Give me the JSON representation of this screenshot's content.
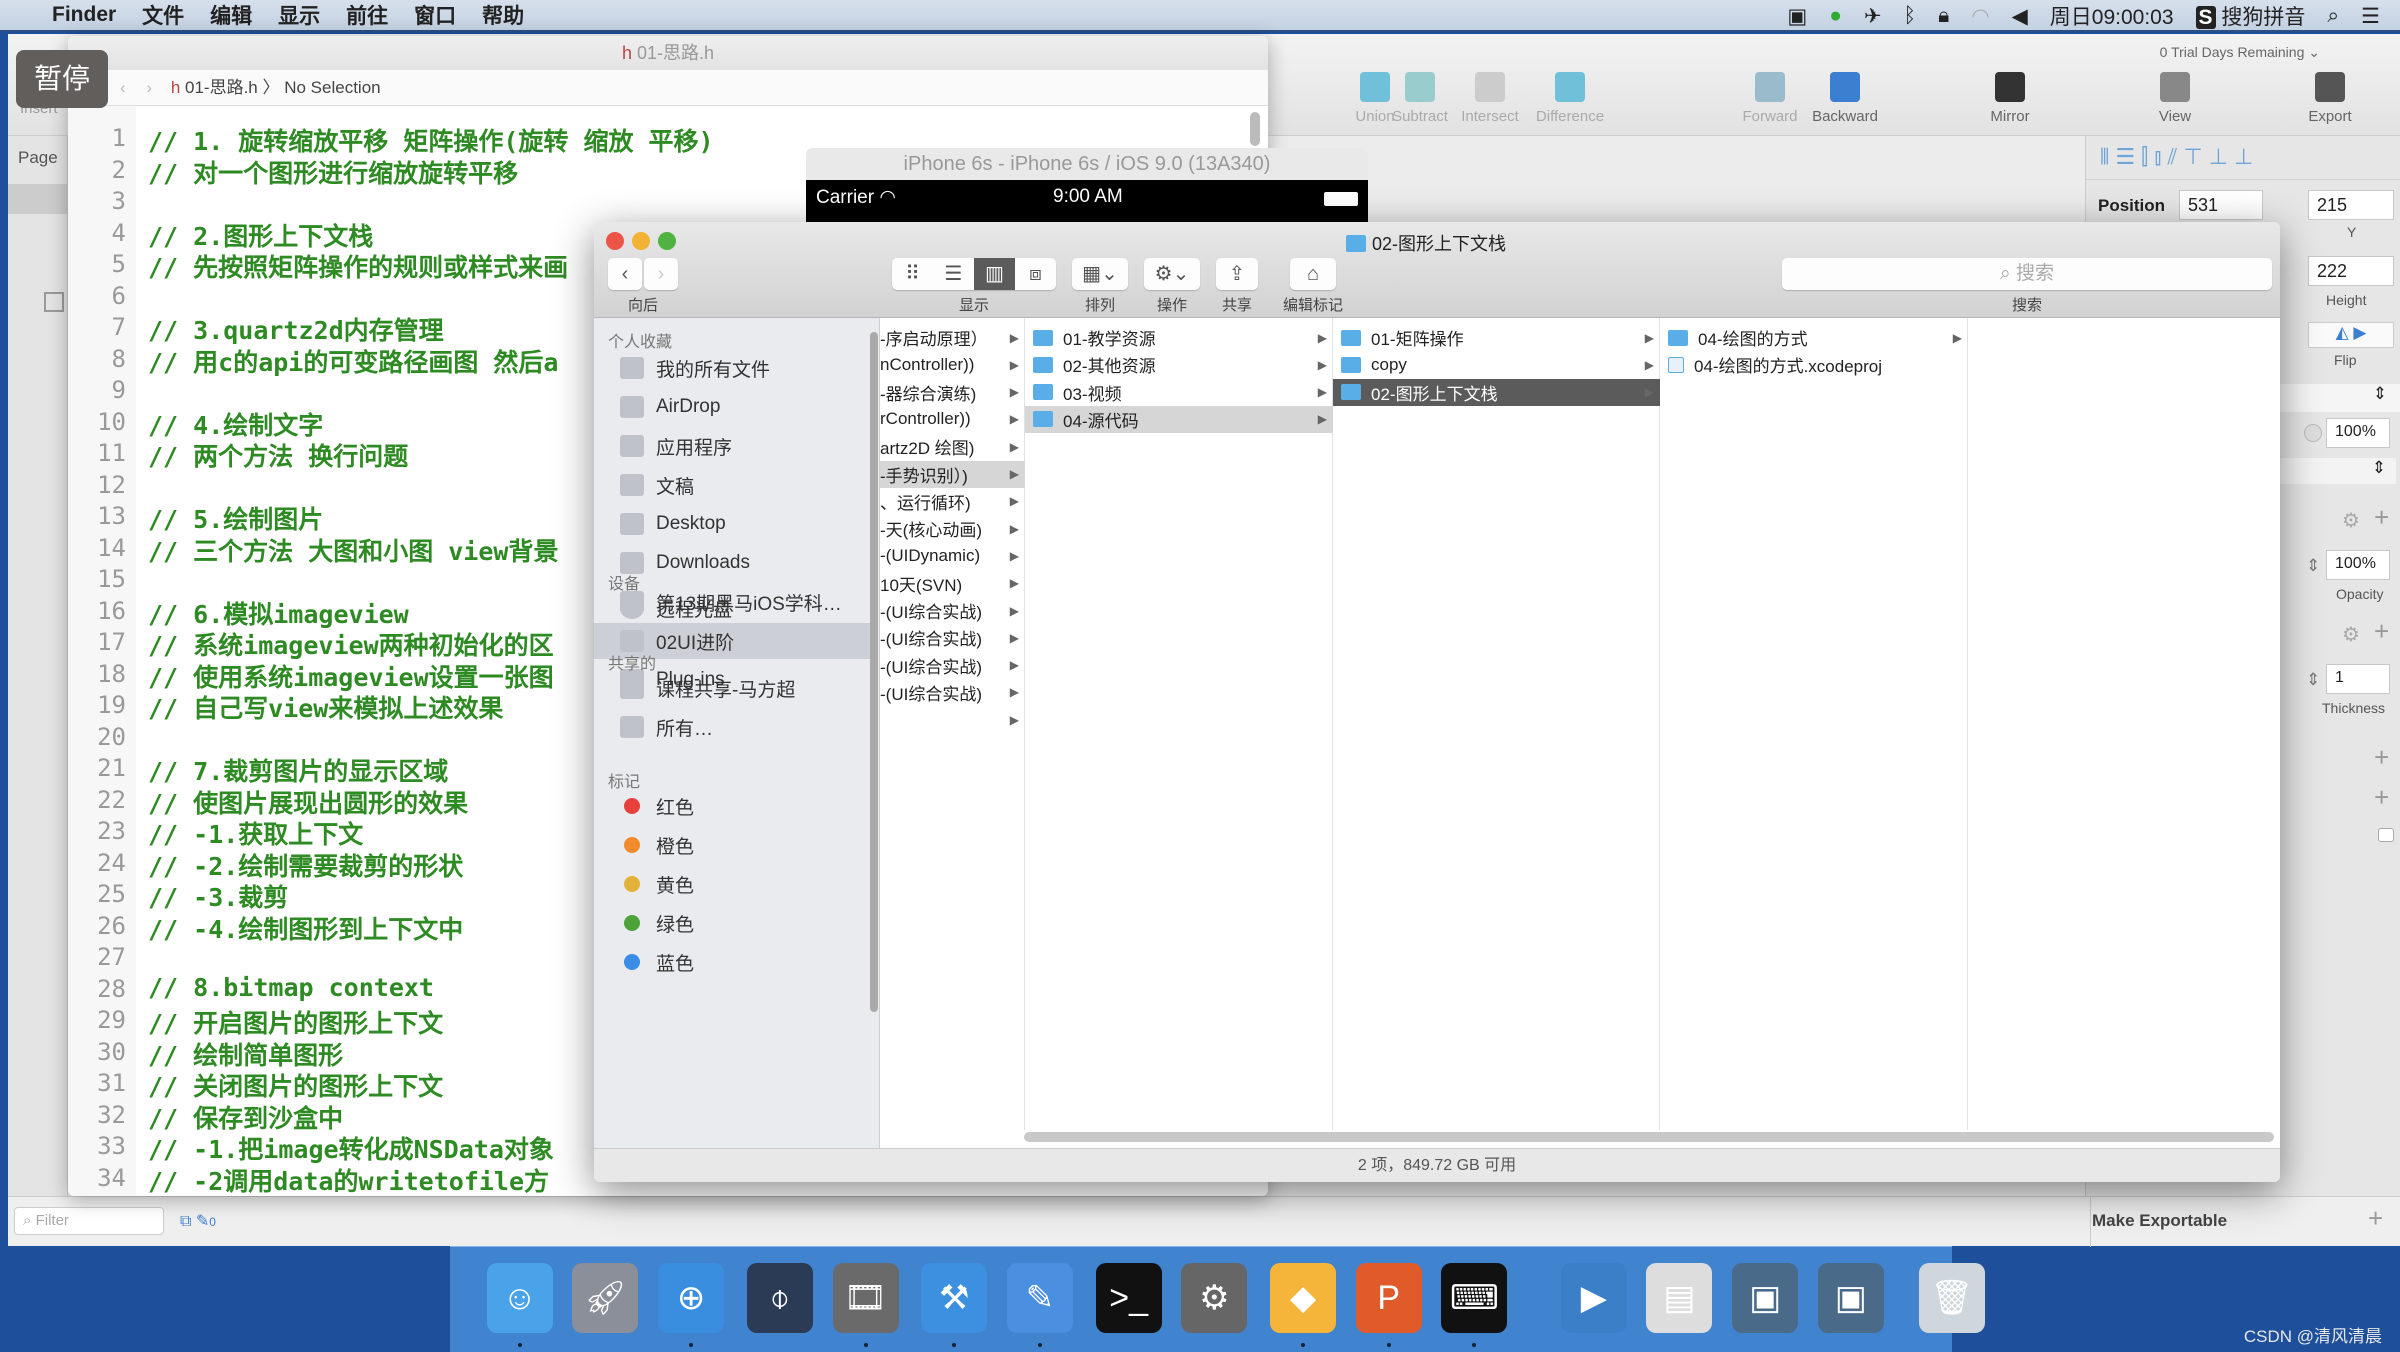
{
  "menubar": {
    "app": "Finder",
    "items": [
      "文件",
      "编辑",
      "显示",
      "前往",
      "窗口",
      "帮助"
    ],
    "clock": "周日09:00:03",
    "ime": "搜狗拼音"
  },
  "pause_label": "暂停",
  "sketch": {
    "trial": "0 Trial Days Remaining",
    "toolbar": [
      "Union",
      "Subtract",
      "Intersect",
      "Difference",
      "Forward",
      "Backward",
      "Mirror",
      "View",
      "Export"
    ],
    "left": {
      "insert": "Insert",
      "page": "Page"
    },
    "inspector": {
      "position_label": "Position",
      "x": "531",
      "y": "215",
      "y_label": "Y",
      "height": "222",
      "height_label": "Height",
      "flip_label": "Flip",
      "opacity1": "100%",
      "opacity2": "100%",
      "opacity_label": "Opacity",
      "thickness": "1",
      "thickness_label": "Thickness",
      "make_exportable": "Make Exportable"
    },
    "filter_placeholder": "Filter",
    "filter_count": "0"
  },
  "xcode": {
    "title": "01-思路.h",
    "breadcrumb_file": "01-思路.h",
    "breadcrumb_sel": "No Selection",
    "lines": [
      "// 1. 旋转缩放平移 矩阵操作(旋转 缩放 平移)",
      "// 对一个图形进行缩放旋转平移",
      "",
      "// 2.图形上下文栈",
      "// 先按照矩阵操作的规则或样式来画",
      "",
      "// 3.quartz2d内存管理",
      "// 用c的api的可变路径画图 然后a",
      "",
      "// 4.绘制文字",
      "// 两个方法 换行问题",
      "",
      "// 5.绘制图片",
      "// 三个方法 大图和小图 view背景",
      "",
      "// 6.模拟imageview",
      "// 系统imageview两种初始化的区",
      "// 使用系统imageview设置一张图",
      "// 自己写view来模拟上述效果",
      "",
      "// 7.裁剪图片的显示区域",
      "// 使图片展现出圆形的效果",
      "// -1.获取上下文",
      "// -2.绘制需要裁剪的形状",
      "// -3.裁剪",
      "// -4.绘制图形到上下文中",
      "",
      "// 8.bitmap context",
      "// 开启图片的图形上下文",
      "// 绘制简单图形",
      "// 关闭图片的图形上下文",
      "// 保存到沙盒中",
      "// -1.把image转化成NSData对象",
      "// -2调用data的writetofile方"
    ]
  },
  "simulator": {
    "title": "iPhone 6s - iPhone 6s / iOS 9.0 (13A340)",
    "carrier": "Carrier",
    "time": "9:00 AM"
  },
  "finder": {
    "title": "02-图形上下文栈",
    "toolbar": {
      "back": "向后",
      "view": "显示",
      "arrange": "排列",
      "action": "操作",
      "share": "共享",
      "tags": "编辑标记",
      "search_placeholder": "搜索",
      "search": "搜索"
    },
    "sidebar": {
      "favorites": "个人收藏",
      "fav_items": [
        "我的所有文件",
        "AirDrop",
        "应用程序",
        "文稿",
        "Desktop",
        "Downloads",
        "第13期黑马iOS学科…",
        "02UI进阶",
        "Plug-ins"
      ],
      "selected": "02UI进阶",
      "devices": "设备",
      "device_items": [
        "远程光盘"
      ],
      "shared": "共享的",
      "shared_items": [
        "课程共享-马方超",
        "所有…"
      ],
      "tags": "标记",
      "tag_items": [
        {
          "label": "红色",
          "color": "#e8413c"
        },
        {
          "label": "橙色",
          "color": "#f08a2c"
        },
        {
          "label": "黄色",
          "color": "#e3b13a"
        },
        {
          "label": "绿色",
          "color": "#4ea23a"
        },
        {
          "label": "蓝色",
          "color": "#3a8de6"
        }
      ]
    },
    "columns": [
      [
        "-序启动原理）",
        "nController))",
        "-器综合演练)",
        "rController))",
        "artz2D 绘图)",
        "-手势识别）)",
        "、运行循环)",
        "-天(核心动画)",
        "-(UIDynamic)",
        "10天(SVN)",
        "-(UI综合实战)",
        "-(UI综合实战)",
        "-(UI综合实战)",
        "-(UI综合实战)",
        ""
      ],
      [
        "01-教学资源",
        "02-其他资源",
        "03-视频",
        "04-源代码"
      ],
      [
        "01-矩阵操作",
        "copy",
        "02-图形上下文栈"
      ],
      [
        "04-绘图的方式",
        "04-绘图的方式.xcodeproj"
      ]
    ],
    "status": "2 项，849.72 GB 可用"
  },
  "dock": [
    "Finder",
    "Launchpad",
    "Safari",
    "Mouse",
    "Photo Slideshow",
    "Xcode",
    "Instruments",
    "Terminal",
    "System Preferences",
    "Sketch",
    "PowerPoint",
    "Console",
    "QuickTime",
    "Preview",
    "Screen Sharing",
    "Screen Sharing 2",
    "Trash"
  ],
  "watermark": "CSDN @清风清晨"
}
